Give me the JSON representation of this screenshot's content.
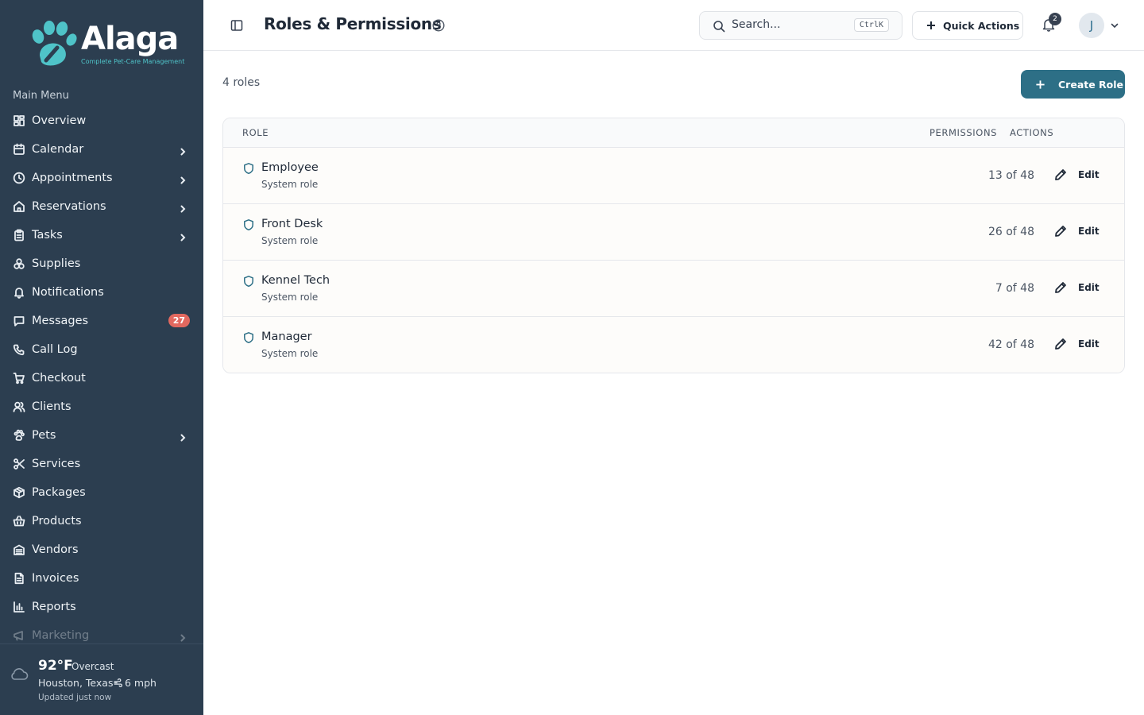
{
  "brand": {
    "name": "Alaga",
    "tagline": "Complete Pet-Care Management",
    "accent": "#2d6f86",
    "sidebar_bg": "#2c3e50",
    "logo_teal": "#4fc3c8"
  },
  "sidebar": {
    "section_title": "Main Menu",
    "items": [
      {
        "label": "Overview",
        "icon": "grid-icon",
        "chevron": false
      },
      {
        "label": "Calendar",
        "icon": "calendar-icon",
        "chevron": true
      },
      {
        "label": "Appointments",
        "icon": "clock-icon",
        "chevron": true
      },
      {
        "label": "Reservations",
        "icon": "home-icon",
        "chevron": true
      },
      {
        "label": "Tasks",
        "icon": "clipboard-icon",
        "chevron": true
      },
      {
        "label": "Supplies",
        "icon": "boxes-icon",
        "chevron": false
      },
      {
        "label": "Notifications",
        "icon": "bell-icon",
        "chevron": false
      },
      {
        "label": "Messages",
        "icon": "message-icon",
        "chevron": false,
        "badge": "27"
      },
      {
        "label": "Call Log",
        "icon": "phone-icon",
        "chevron": false
      },
      {
        "label": "Checkout",
        "icon": "cart-icon",
        "chevron": false
      },
      {
        "label": "Clients",
        "icon": "users-icon",
        "chevron": false
      },
      {
        "label": "Pets",
        "icon": "paw-icon",
        "chevron": true
      },
      {
        "label": "Services",
        "icon": "scissors-icon",
        "chevron": false
      },
      {
        "label": "Packages",
        "icon": "package-icon",
        "chevron": false
      },
      {
        "label": "Products",
        "icon": "basket-icon",
        "chevron": false
      },
      {
        "label": "Vendors",
        "icon": "vendor-icon",
        "chevron": false
      },
      {
        "label": "Invoices",
        "icon": "file-icon",
        "chevron": false
      },
      {
        "label": "Reports",
        "icon": "chart-icon",
        "chevron": false
      },
      {
        "label": "Marketing",
        "icon": "megaphone-icon",
        "chevron": true
      }
    ]
  },
  "weather": {
    "temp": "92°F",
    "condition": "Overcast",
    "location": "Houston, Texas",
    "wind": "6 mph",
    "updated": "Updated just now"
  },
  "header": {
    "title": "Roles & Permissions",
    "search_placeholder": "Search...",
    "search_shortcut": "CtrlK",
    "quick_actions": "Quick Actions",
    "notification_count": "2",
    "avatar_initial": "J"
  },
  "content": {
    "count_label": "4 roles",
    "create_button": "Create Role",
    "columns": {
      "role": "ROLE",
      "permissions": "PERMISSIONS",
      "actions": "ACTIONS"
    },
    "rows": [
      {
        "name": "Employee",
        "type": "System role",
        "permissions": "13 of 48",
        "action": "Edit"
      },
      {
        "name": "Front Desk",
        "type": "System role",
        "permissions": "26 of 48",
        "action": "Edit"
      },
      {
        "name": "Kennel Tech",
        "type": "System role",
        "permissions": "7 of 48",
        "action": "Edit"
      },
      {
        "name": "Manager",
        "type": "System role",
        "permissions": "42 of 48",
        "action": "Edit"
      }
    ]
  }
}
